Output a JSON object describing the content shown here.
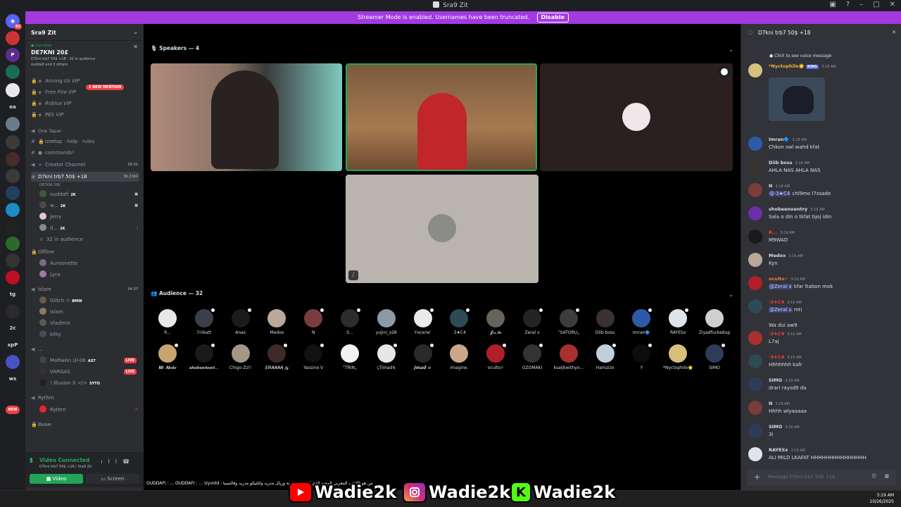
{
  "window": {
    "title": "Sra9 Zit"
  },
  "banner": {
    "text": "Streamer Mode is enabled. Usernames have been truncated.",
    "button": "Disable"
  },
  "rail": {
    "badge_top": "62",
    "ea_label": "ea",
    "tg_label": "tg",
    "2c_label": "2c",
    "xp_label": "xpP",
    "ws_label": "ws",
    "new_badge": "NEW"
  },
  "sidebar": {
    "server_name": "Sra9 Zit",
    "live_label": "Live Now",
    "live_channel": "DE7KNI 20£",
    "live_sub": "D7kni trb7 50$ +18 · 32 in audience",
    "live_sub2": "ouddafi and 3 others",
    "mention": "1 NEW MENTION",
    "channels": [
      {
        "label": "Among Us VIP"
      },
      {
        "label": "Free Fire VIP"
      },
      {
        "label": "Roblox VIP"
      },
      {
        "label": "PES VIP"
      }
    ],
    "category_onetap": "One Tapat ·",
    "onetap_ch": "onetap · help · rules",
    "commands_ch": "commands²",
    "creator_channel": "Creator Channel",
    "creator_counts": "00 01",
    "voice_channel": "D7kni trb7 50$ +18",
    "voice_counts": "36 2160",
    "voice_sub": "DE7KNI 20£",
    "voice_users": [
      {
        "name": "ouddafi",
        "tag": "2K"
      },
      {
        "name": "w...",
        "tag": "2K"
      },
      {
        "name": "Jerry",
        "tag": ""
      },
      {
        "name": "d...",
        "tag": "2K"
      }
    ],
    "audience_count": "32 in audience",
    "offline_ch": "Offline",
    "offline_users": [
      {
        "name": "Aurounette"
      },
      {
        "name": "Lyra"
      }
    ],
    "islam_ch": "Islam",
    "islam_counts": "04 07",
    "islam_users": [
      {
        "name": "Glitch !!",
        "tag": "BMW"
      },
      {
        "name": "Islam",
        "tag": ""
      },
      {
        "name": "Vladimir",
        "tag": ""
      },
      {
        "name": "kitty",
        "tag": ""
      }
    ],
    "dots_ch": "...",
    "live_users": [
      {
        "name": "MaRwAn Ui-06",
        "tag": "AST",
        "live": "LIVE"
      },
      {
        "name": "VARGAS",
        "tag": "",
        "live": "LIVE"
      },
      {
        "name": "! Illusion X </>",
        "tag": "SYTO",
        "live": ""
      }
    ],
    "rythm_cat": "Rythm",
    "rythm_user": "Rythm",
    "bwam_cat": "Виам",
    "voice_connected": "Video Connected",
    "voice_connected_sub": "D7kni trb7 50$ +18 / Sra9 Zit",
    "video_btn": "Video",
    "screen_btn": "Screen"
  },
  "main": {
    "speakers_header": "Speakers — 4",
    "audience_header": "Audience — 32",
    "audience": [
      {
        "name": "R...",
        "color": "#e8e8e8"
      },
      {
        "name": "7nikatt",
        "color": "#3a3f4a"
      },
      {
        "name": "Anas",
        "color": "#1b1b1b"
      },
      {
        "name": "Medox",
        "color": "#b9a99b"
      },
      {
        "name": "N",
        "color": "#7a3c3c"
      },
      {
        "name": "S...",
        "color": "#2c2c2c"
      },
      {
        "name": "yujini_s28",
        "color": "#8d9aa6"
      },
      {
        "name": "Үнсепе'",
        "color": "#eaeaea"
      },
      {
        "name": "·3★C4",
        "color": "#2e4a54"
      },
      {
        "name": "𝓙𝓻𝓲.𝓽𝓪",
        "color": "#67625c"
      },
      {
        "name": "Zeral x",
        "color": "#242424"
      },
      {
        "name": "⸢SATORU⸥",
        "color": "#3c3c3c"
      },
      {
        "name": "Diib boss",
        "color": "#3a3230"
      },
      {
        "name": "Imran🔷",
        "color": "#2d5aa8"
      },
      {
        "name": "RAYESx",
        "color": "#dfe3ea"
      },
      {
        "name": "Ziyadfuckedup",
        "color": "#cfcfcf"
      },
      {
        "name": "𝑴𝒓 𝑨𝒃𝒅𝒐",
        "color": "#c8a470"
      },
      {
        "name": "𝒔𝒉𝒐𝒃𝒆𝒆𝒏𝒐𝒆𝒏...",
        "color": "#1a1a1a"
      },
      {
        "name": "Chigo Zz!!",
        "color": "#a39785"
      },
      {
        "name": "𝑬𝑹𝑨𝑨𝑨𝑨 𝒻𝓎",
        "color": "#3d2a2a"
      },
      {
        "name": "Yassine V",
        "color": "#111"
      },
      {
        "name": "⸢TRIN⸥",
        "color": "#f2f2f2"
      },
      {
        "name": "ҁTimaḋ↯",
        "color": "#e6e6e6"
      },
      {
        "name": "𝙅𝙢𝙖𝙙 ☠",
        "color": "#2a2a2a"
      },
      {
        "name": "imagine.",
        "color": "#c9a78a"
      },
      {
        "name": "oculto⚡",
        "color": "#b01f2a"
      },
      {
        "name": "OZOMAKI",
        "color": "#333"
      },
      {
        "name": "ksaljkwithyo...",
        "color": "#a8302f"
      },
      {
        "name": "Hamzizo",
        "color": "#c0d0d8"
      },
      {
        "name": "Y",
        "color": "#0d0d0d"
      },
      {
        "name": "*Nyctophile🌟",
        "color": "#d6c07b"
      },
      {
        "name": "SIMO",
        "color": "#2e3c5a"
      }
    ]
  },
  "chat": {
    "title": "D7kni trb7 50$ +18",
    "voice_hint": "Click to see voice message",
    "first_user": "*Nyctophile🌟",
    "first_tag": "KING",
    "first_time": "3:18 AM",
    "messages": [
      {
        "user": "Imran🔷",
        "color": "#dbdee1",
        "time": "3:18 AM",
        "mention": "",
        "text": "Chkon swl wahd kfat",
        "avatar": "#2d5aa8"
      },
      {
        "user": "Diib boss",
        "color": "#dbdee1",
        "time": "3:18 AM",
        "mention": "",
        "text": "AHLA NAS   AHLA NAS",
        "avatar": "#3a3230"
      },
      {
        "user": "N",
        "color": "#dbdee1",
        "time": "3:18 AM",
        "mention": "@·3★C4",
        "text": "chl9mo l7ssade",
        "avatar": "#7a3c3c"
      },
      {
        "user": "shobeenoentry",
        "color": "#dbdee1",
        "time": "3:19 AM",
        "mention": "",
        "text": "Sala o din o tkfat bjoj idin",
        "avatar": "#6b2fa8"
      },
      {
        "user": "R...",
        "color": "#f23f43",
        "time": "3:19 AM",
        "mention": "",
        "text": "M9WAD",
        "avatar": "#1a1a1a"
      },
      {
        "user": "Medox",
        "color": "#dbdee1",
        "time": "3:19 AM",
        "mention": "",
        "text": "Kyn",
        "avatar": "#b9a99b"
      },
      {
        "user": "oculto⚡",
        "color": "#f07a4a",
        "time": "3:19 AM",
        "mention": "@Zeral x",
        "text": "kfar ltabon mok",
        "avatar": "#b01f2a"
      },
      {
        "user": "·3★C4",
        "color": "#f23f43",
        "time": "3:19 AM",
        "mention": "@Zeral x",
        "text": "mti",
        "avatar": "#2e4a54"
      },
      {
        "user": "",
        "color": "#dbdee1",
        "time": "",
        "mention": "",
        "text": "Wa dui aw9",
        "avatar": ""
      },
      {
        "user": "·3★C4",
        "color": "#f23f43",
        "time": "3:19 AM",
        "mention": "",
        "text": "L7aj",
        "avatar": "#a8302f"
      },
      {
        "user": "·3★C4",
        "color": "#f23f43",
        "time": "3:19 AM",
        "mention": "",
        "text": "Hhhhhhh kafr",
        "avatar": "#2e4a54"
      },
      {
        "user": "SIMO",
        "color": "#dbdee1",
        "time": "3:19 AM",
        "mention": "",
        "text": "drari raysd9 da",
        "avatar": "#2e3c5a"
      },
      {
        "user": "N",
        "color": "#dbdee1",
        "time": "3:19 AM",
        "mention": "",
        "text": "Hhhh wlyaaaaa",
        "avatar": "#7a3c3c"
      },
      {
        "user": "SIMO",
        "color": "#dbdee1",
        "time": "3:19 AM",
        "mention": "",
        "text": "3i",
        "avatar": "#2e3c5a"
      },
      {
        "user": "RAYESx",
        "color": "#dbdee1",
        "time": "3:19 AM",
        "mention": "",
        "text": "ALI MILD LKAFAT HHHHHHHHHHHHHHH",
        "avatar": "#dfe3ea"
      }
    ],
    "placeholder": "Message D7kni trb7 50$ +18"
  },
  "overlay": {
    "ticker": "OUDDAFI : ... OUDDAFI : ... izyvold : من هو اللاعب المغربي الوحيد الذي لعب لبرشلونة وريال مدريد واتلتيكو مدريد وفالنسيا",
    "yt": "Wadie2k",
    "ig": "Wadie2k",
    "kick": "Wadie2k"
  },
  "taskbar": {
    "time": "3:19 AM",
    "date": "10/26/2025"
  }
}
